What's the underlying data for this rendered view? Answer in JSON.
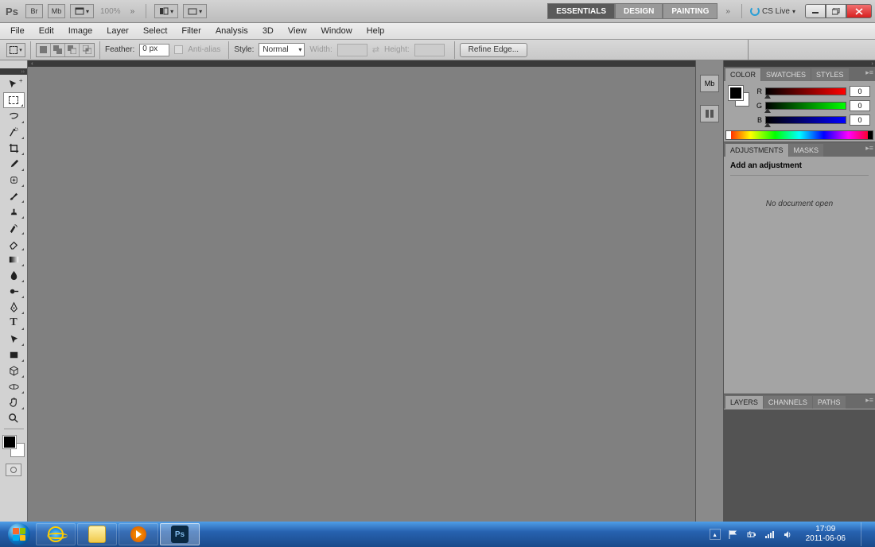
{
  "titlebar": {
    "app": "Ps",
    "btn_br": "Br",
    "btn_mb": "Mb",
    "zoom": "100%",
    "workspaces": [
      "ESSENTIALS",
      "DESIGN",
      "PAINTING"
    ],
    "cslive": "CS Live"
  },
  "menu": [
    "File",
    "Edit",
    "Image",
    "Layer",
    "Select",
    "Filter",
    "Analysis",
    "3D",
    "View",
    "Window",
    "Help"
  ],
  "options": {
    "feather_label": "Feather:",
    "feather_value": "0 px",
    "antialias": "Anti-alias",
    "style_label": "Style:",
    "style_value": "Normal",
    "width_label": "Width:",
    "height_label": "Height:",
    "refine": "Refine Edge..."
  },
  "color_panel": {
    "tabs": [
      "COLOR",
      "SWATCHES",
      "STYLES"
    ],
    "channels": [
      {
        "label": "R",
        "value": "0"
      },
      {
        "label": "G",
        "value": "0"
      },
      {
        "label": "B",
        "value": "0"
      }
    ]
  },
  "adjustments_panel": {
    "tabs": [
      "ADJUSTMENTS",
      "MASKS"
    ],
    "title": "Add an adjustment",
    "msg": "No document open"
  },
  "layers_panel": {
    "tabs": [
      "LAYERS",
      "CHANNELS",
      "PATHS"
    ]
  },
  "taskbar": {
    "time": "17:09",
    "date": "2011-06-06"
  }
}
